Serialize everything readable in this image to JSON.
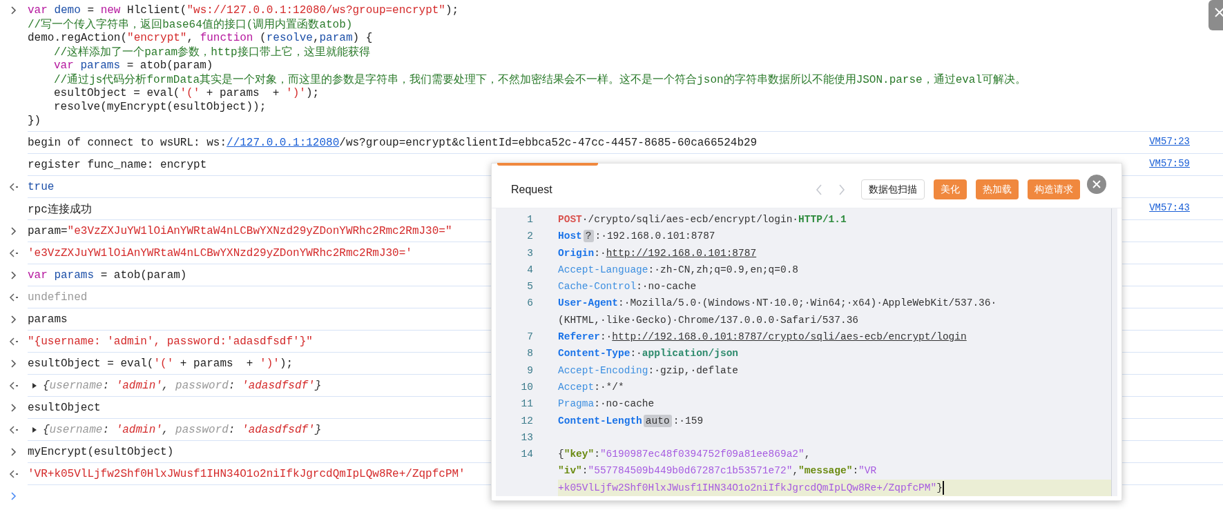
{
  "console": {
    "entries": [
      {
        "kind": "input",
        "lines": [
          {
            "tokens": [
              {
                "kind": "kw",
                "t": "var"
              },
              {
                "kind": "var",
                "t": " demo"
              },
              {
                "kind": "plain",
                "t": " = "
              },
              {
                "kind": "kw",
                "t": "new"
              },
              {
                "kind": "plain",
                "t": " Hlclient("
              },
              {
                "kind": "str",
                "t": "\"ws://127.0.0.1:12080/ws?group=encrypt\""
              },
              {
                "kind": "plain",
                "t": ");"
              }
            ]
          },
          {
            "tokens": [
              {
                "kind": "comment",
                "t": "//写一个传入字符串，返回base64值的接口(调用内置函数atob)"
              }
            ]
          },
          {
            "tokens": [
              {
                "kind": "plain",
                "t": "demo.regAction("
              },
              {
                "kind": "str",
                "t": "\"encrypt\""
              },
              {
                "kind": "plain",
                "t": ", "
              },
              {
                "kind": "kw",
                "t": "function"
              },
              {
                "kind": "plain",
                "t": " ("
              },
              {
                "kind": "var",
                "t": "resolve"
              },
              {
                "kind": "plain",
                "t": ","
              },
              {
                "kind": "var",
                "t": "param"
              },
              {
                "kind": "plain",
                "t": ") {"
              }
            ],
            "children": [
              {
                "tokens": [
                  {
                    "kind": "comment",
                    "t": "//这样添加了一个param参数，http接口带上它，这里就能获得"
                  }
                ]
              },
              {
                "tokens": [
                  {
                    "kind": "kw",
                    "t": "var"
                  },
                  {
                    "kind": "var",
                    "t": " params"
                  },
                  {
                    "kind": "plain",
                    "t": " = atob(param)"
                  }
                ]
              },
              {
                "tokens": [
                  {
                    "kind": "comment",
                    "t": "//通过js代码分析formData其实是一个对象，而这里的参数是字符串，我们需要处理下，不然加密结果会不一样。这不是一个符合json的字符串数据所以不能使用JSON.parse，通过eval可解决。"
                  }
                ]
              },
              {
                "tokens": [
                  {
                    "kind": "plain",
                    "t": "esultObject = eval("
                  },
                  {
                    "kind": "str",
                    "t": "'('"
                  },
                  {
                    "kind": "plain",
                    "t": " + params  + "
                  },
                  {
                    "kind": "str",
                    "t": "')'"
                  },
                  {
                    "kind": "plain",
                    "t": ");"
                  }
                ]
              },
              {
                "tokens": [
                  {
                    "kind": "plain",
                    "t": "resolve(myEncrypt(esultObject));"
                  }
                ]
              }
            ]
          },
          {
            "tokens": [
              {
                "kind": "plain",
                "t": "})"
              }
            ]
          }
        ]
      },
      {
        "kind": "log",
        "source": "VM57:23",
        "lines": [
          {
            "tokens": [
              {
                "kind": "plain",
                "t": "begin of connect to wsURL: ws:"
              },
              {
                "kind": "link",
                "t": "//127.0.0.1:12080"
              },
              {
                "kind": "plain",
                "t": "/ws?group=encrypt&clientId=ebbca52c-47cc-4457-8685-60ca66524b29"
              }
            ]
          }
        ]
      },
      {
        "kind": "log",
        "source": "VM57:59",
        "lines": [
          {
            "tokens": [
              {
                "kind": "plain",
                "t": "register func_name: encrypt"
              }
            ]
          }
        ]
      },
      {
        "kind": "output",
        "lines": [
          {
            "tokens": [
              {
                "kind": "bool",
                "t": "true"
              }
            ]
          }
        ]
      },
      {
        "kind": "log",
        "source": "VM57:43",
        "lines": [
          {
            "tokens": [
              {
                "kind": "plain",
                "t": "rpc连接成功"
              }
            ]
          }
        ]
      },
      {
        "kind": "input",
        "lines": [
          {
            "tokens": [
              {
                "kind": "plain",
                "t": "param="
              },
              {
                "kind": "str",
                "t": "\"e3VzZXJuYW1lOiAnYWRtaW4nLCBwYXNzd29yZDonYWRhc2Rmc2RmJ30=\""
              }
            ]
          }
        ]
      },
      {
        "kind": "output",
        "lines": [
          {
            "tokens": [
              {
                "kind": "str",
                "t": "'e3VzZXJuYW1lOiAnYWRtaW4nLCBwYXNzd29yZDonYWRhc2Rmc2RmJ30='"
              }
            ]
          }
        ]
      },
      {
        "kind": "input",
        "lines": [
          {
            "tokens": [
              {
                "kind": "kw",
                "t": "var"
              },
              {
                "kind": "var",
                "t": " params"
              },
              {
                "kind": "plain",
                "t": " = atob(param)"
              }
            ]
          }
        ]
      },
      {
        "kind": "output",
        "lines": [
          {
            "tokens": [
              {
                "kind": "undef",
                "t": "undefined"
              }
            ]
          }
        ]
      },
      {
        "kind": "input",
        "lines": [
          {
            "tokens": [
              {
                "kind": "plain",
                "t": "params"
              }
            ]
          }
        ]
      },
      {
        "kind": "output",
        "lines": [
          {
            "tokens": [
              {
                "kind": "str",
                "t": "\"{username: 'admin', password:'adasdfsdf'}\""
              }
            ]
          }
        ]
      },
      {
        "kind": "input",
        "lines": [
          {
            "tokens": [
              {
                "kind": "plain",
                "t": "esultObject = eval("
              },
              {
                "kind": "str",
                "t": "'('"
              },
              {
                "kind": "plain",
                "t": " + params  + "
              },
              {
                "kind": "str",
                "t": "')'"
              },
              {
                "kind": "plain",
                "t": ");"
              }
            ]
          }
        ]
      },
      {
        "kind": "object",
        "expanded": false,
        "lines": [
          {
            "tokens": [
              {
                "kind": "punct",
                "t": "{"
              },
              {
                "kind": "key",
                "t": "username"
              },
              {
                "kind": "punct",
                "t": ": "
              },
              {
                "kind": "val",
                "t": "'admin'"
              },
              {
                "kind": "punct",
                "t": ", "
              },
              {
                "kind": "key",
                "t": "password"
              },
              {
                "kind": "punct",
                "t": ": "
              },
              {
                "kind": "val",
                "t": "'adasdfsdf'"
              },
              {
                "kind": "punct",
                "t": "}"
              }
            ]
          }
        ]
      },
      {
        "kind": "input",
        "lines": [
          {
            "tokens": [
              {
                "kind": "plain",
                "t": "esultObject"
              }
            ]
          }
        ]
      },
      {
        "kind": "object",
        "expanded": false,
        "lines": [
          {
            "tokens": [
              {
                "kind": "punct",
                "t": "{"
              },
              {
                "kind": "key",
                "t": "username"
              },
              {
                "kind": "punct",
                "t": ": "
              },
              {
                "kind": "val",
                "t": "'admin'"
              },
              {
                "kind": "punct",
                "t": ", "
              },
              {
                "kind": "key",
                "t": "password"
              },
              {
                "kind": "punct",
                "t": ": "
              },
              {
                "kind": "val",
                "t": "'adasdfsdf'"
              },
              {
                "kind": "punct",
                "t": "}"
              }
            ]
          }
        ]
      },
      {
        "kind": "input",
        "lines": [
          {
            "tokens": [
              {
                "kind": "plain",
                "t": "myEncrypt(esultObject)"
              }
            ]
          }
        ]
      },
      {
        "kind": "output",
        "lines": [
          {
            "tokens": [
              {
                "kind": "str",
                "t": "'VR+k05VlLjfw2Shf0HlxJWusf1IHN34O1o2niIfkJgrcdQmIpLQw8Re+/ZqpfcPM'"
              }
            ]
          }
        ]
      },
      {
        "kind": "prompt"
      }
    ]
  },
  "request_panel": {
    "title": "Request",
    "buttons": [
      {
        "label": "数据包扫描",
        "kind": "outline"
      },
      {
        "label": "美化",
        "kind": "primary"
      },
      {
        "label": "热加载",
        "kind": "primary"
      },
      {
        "label": "构造请求",
        "kind": "primary"
      }
    ],
    "lines": [
      {
        "number": "1",
        "rows": [
          {
            "tokens": [
              {
                "kind": "method",
                "t": "POST"
              },
              {
                "kind": "plain",
                "t": "·/crypto/sqli/aes-ecb/encrypt/login·"
              },
              {
                "kind": "proto",
                "t": "HTTP/1.1"
              }
            ]
          }
        ]
      },
      {
        "number": "2",
        "rows": [
          {
            "tokens": [
              {
                "kind": "hname",
                "t": "Host"
              },
              {
                "kind": "badge",
                "t": "?"
              },
              {
                "kind": "plain",
                "t": ":·192.168.0.101:8787"
              }
            ]
          }
        ]
      },
      {
        "number": "3",
        "rows": [
          {
            "tokens": [
              {
                "kind": "hname",
                "t": "Origin"
              },
              {
                "kind": "plain",
                "t": ":·"
              },
              {
                "kind": "link",
                "t": "http://192.168.0.101:8787"
              }
            ]
          }
        ]
      },
      {
        "number": "4",
        "rows": [
          {
            "tokens": [
              {
                "kind": "hname2",
                "t": "Accept-Language"
              },
              {
                "kind": "plain",
                "t": ":·zh-CN,zh;q=0.9,en;q=0.8"
              }
            ]
          }
        ]
      },
      {
        "number": "5",
        "rows": [
          {
            "tokens": [
              {
                "kind": "hname2",
                "t": "Cache-Control"
              },
              {
                "kind": "plain",
                "t": ":·no-cache"
              }
            ]
          }
        ]
      },
      {
        "number": "6",
        "rows": [
          {
            "tokens": [
              {
                "kind": "hname",
                "t": "User-Agent"
              },
              {
                "kind": "plain",
                "t": ":·Mozilla/5.0·(Windows·NT·10.0;·Win64;·x64)·AppleWebKit/537.36·"
              }
            ]
          },
          {
            "tokens": [
              {
                "kind": "plain",
                "t": "(KHTML,·like·Gecko)·Chrome/137.0.0.0·Safari/537.36"
              }
            ]
          }
        ]
      },
      {
        "number": "7",
        "rows": [
          {
            "tokens": [
              {
                "kind": "hname",
                "t": "Referer"
              },
              {
                "kind": "plain",
                "t": ":·"
              },
              {
                "kind": "link",
                "t": "http://192.168.0.101:8787/crypto/sqli/aes-ecb/encrypt/login"
              }
            ]
          }
        ]
      },
      {
        "number": "8",
        "rows": [
          {
            "tokens": [
              {
                "kind": "hname",
                "t": "Content-Type"
              },
              {
                "kind": "plain",
                "t": ":·"
              },
              {
                "kind": "green",
                "t": "application/json"
              }
            ]
          }
        ]
      },
      {
        "number": "9",
        "rows": [
          {
            "tokens": [
              {
                "kind": "hname2",
                "t": "Accept-Encoding"
              },
              {
                "kind": "plain",
                "t": ":·gzip,·deflate"
              }
            ]
          }
        ]
      },
      {
        "number": "10",
        "rows": [
          {
            "tokens": [
              {
                "kind": "hname2",
                "t": "Accept"
              },
              {
                "kind": "plain",
                "t": ":·*/*"
              }
            ]
          }
        ]
      },
      {
        "number": "11",
        "rows": [
          {
            "tokens": [
              {
                "kind": "hname2",
                "t": "Pragma"
              },
              {
                "kind": "plain",
                "t": ":·no-cache"
              }
            ]
          }
        ]
      },
      {
        "number": "12",
        "rows": [
          {
            "tokens": [
              {
                "kind": "hname",
                "t": "Content-Length"
              },
              {
                "kind": "badge",
                "t": "auto"
              },
              {
                "kind": "plain",
                "t": ":·159"
              }
            ]
          }
        ]
      },
      {
        "number": "13"
      },
      {
        "number": "14",
        "rows": [
          {
            "current": false,
            "tokens": [
              {
                "kind": "plain",
                "t": "{"
              },
              {
                "kind": "jkey",
                "t": "\"key\""
              },
              {
                "kind": "plain",
                "t": ":"
              },
              {
                "kind": "jstr",
                "t": "\"6190987ec48f0394752f09a81ee869a2\""
              },
              {
                "kind": "plain",
                "t": ","
              }
            ]
          },
          {
            "current": false,
            "tokens": [
              {
                "kind": "jkey",
                "t": "\"iv\""
              },
              {
                "kind": "plain",
                "t": ":"
              },
              {
                "kind": "jstr",
                "t": "\"557784509b449b0d67287c1b53571e72\""
              },
              {
                "kind": "plain",
                "t": ","
              },
              {
                "kind": "jkey",
                "t": "\"message\""
              },
              {
                "kind": "plain",
                "t": ":"
              },
              {
                "kind": "jstr",
                "t": "\"VR"
              }
            ]
          },
          {
            "current": true,
            "tokens": [
              {
                "kind": "jstr",
                "t": "+k05VlLjfw2Shf0HlxJWusf1IHN34O1o2niIfkJgrcdQmIpLQw8Re+/ZqpfcPM\""
              },
              {
                "kind": "plain",
                "t": "}"
              }
            ]
          }
        ]
      }
    ]
  }
}
